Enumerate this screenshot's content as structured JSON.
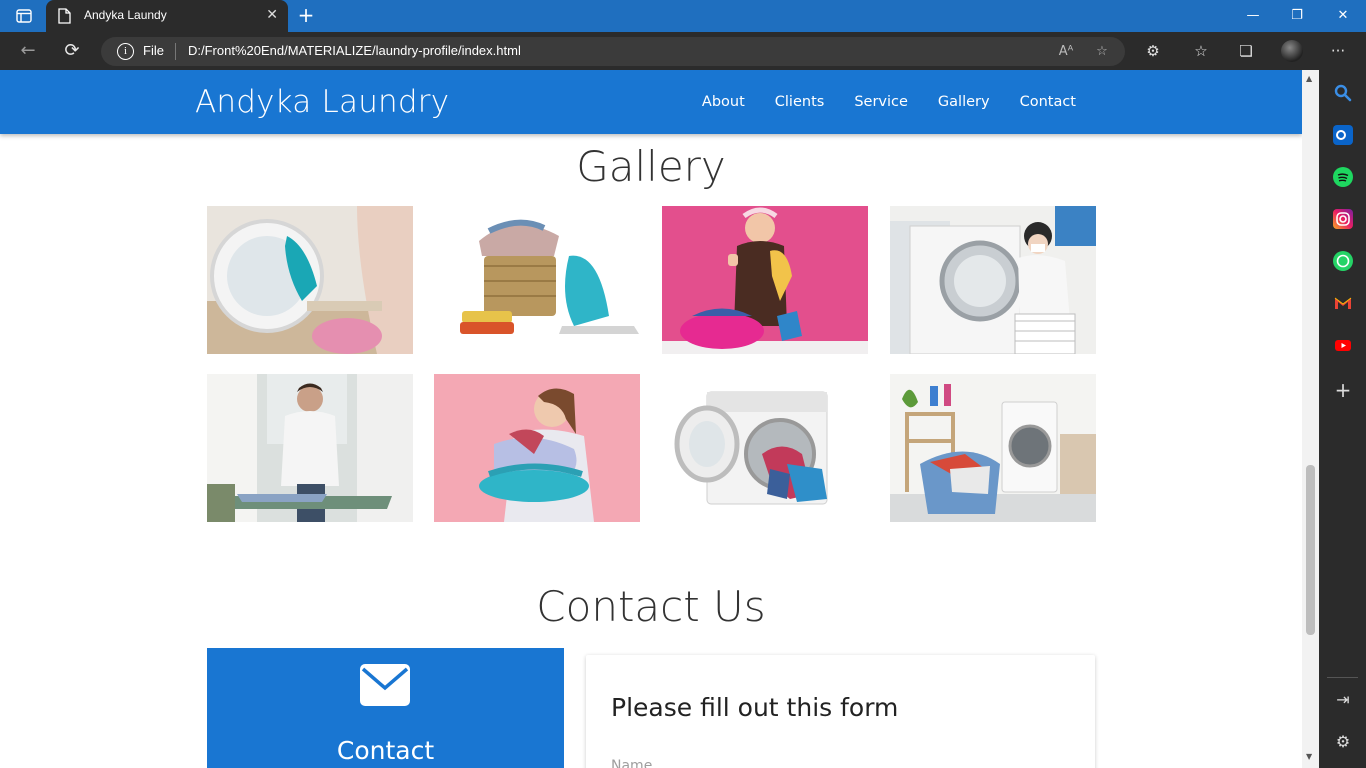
{
  "browser": {
    "tab_title": "Andyka Laundy",
    "file_label": "File",
    "url": "D:/Front%20End/MATERIALIZE/laundry-profile/index.html"
  },
  "site": {
    "brand": "Andyka Laundry",
    "nav": [
      "About",
      "Clients",
      "Service",
      "Gallery",
      "Contact"
    ]
  },
  "gallery": {
    "title": "Gallery",
    "images": [
      "woman-loading-washing-machine",
      "laundry-basket-with-iron",
      "woman-thumbs-up-pink-background",
      "woman-mask-washing-machine",
      "man-ironing-shirt",
      "woman-holding-laundry-pink",
      "washing-machine-with-clothes",
      "laundry-room-washing-machine"
    ]
  },
  "contact": {
    "title": "Contact Us",
    "card_title": "Contact",
    "form_title": "Please fill out this form",
    "name_placeholder": "Name"
  },
  "colors": {
    "brand_blue": "#1976d2",
    "chrome_dark": "#2b2b2b",
    "titlebar_blue": "#1f6fbf"
  }
}
